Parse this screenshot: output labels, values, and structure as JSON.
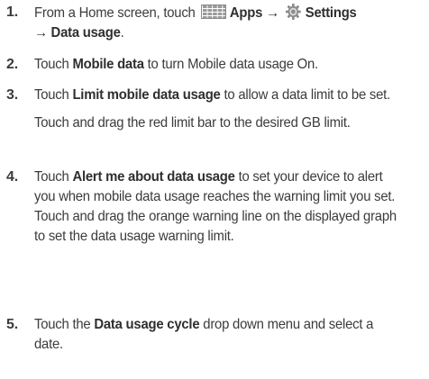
{
  "steps": [
    {
      "num": "1.",
      "prefix": "From a Home screen, touch ",
      "apps_label": "Apps",
      "arrow1": " → ",
      "settings_label": "Settings",
      "arrow2": "→ ",
      "data_usage_label": "Data usage",
      "suffix": "."
    },
    {
      "num": "2.",
      "prefix": "Touch ",
      "bold": "Mobile data",
      "suffix": " to turn Mobile data usage On."
    },
    {
      "num": "3.",
      "prefix": "Touch ",
      "bold": "Limit mobile data usage",
      "suffix": " to allow a data limit to be set.",
      "sub": "Touch and drag the red limit bar to the desired GB limit."
    },
    {
      "num": "4.",
      "prefix": "Touch ",
      "bold": "Alert me about data usage",
      "suffix": " to set your device to alert you when mobile data usage reaches the warning limit you set. Touch and drag the orange warning line on the displayed graph to set the data usage warning limit."
    },
    {
      "num": "5.",
      "prefix": "Touch the ",
      "bold": "Data usage cycle",
      "suffix": " drop down menu and select a date."
    }
  ],
  "icons": {
    "apps": "apps-grid-icon",
    "settings": "settings-gear-icon"
  }
}
